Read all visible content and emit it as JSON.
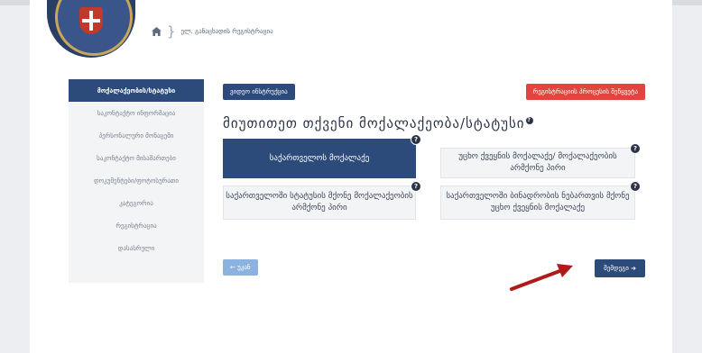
{
  "breadcrumb": {
    "text": "ელ. განაცხადის რეგისტრაცია"
  },
  "sidebar": {
    "items": [
      {
        "label": "მოქალაქეობის/სტატუსი"
      },
      {
        "label": "საკონტაქტო ინფორმაცია"
      },
      {
        "label": "პერსონალური მონაცემი"
      },
      {
        "label": "საკონტაქტო მისამართები"
      },
      {
        "label": "დოკუმენტები/ფოტოსურათი"
      },
      {
        "label": "კატეგორია"
      },
      {
        "label": "რეგისტრაცია"
      },
      {
        "label": "დასასრული"
      }
    ]
  },
  "main": {
    "top_left_button": "ვიდეო ინსტრუქცია",
    "top_right_button": "რეგისტრაციის პროცესის შეწყვეტა",
    "heading": "მიუთითეთ თქვენი მოქალაქეობა/სტატუსი",
    "options": [
      {
        "label": "საქართველოს მოქალაქე"
      },
      {
        "label": "უცხო ქვეყნის მოქალაქე/ მოქალაქეობის არმქონე პირი"
      },
      {
        "label": "საქართველოში სტატუსის მქონე მოქალაქეობის არმქონე პირი"
      },
      {
        "label": "საქართველოში ბინადრობის ნებართვის მქონე უცხო ქვეყნის მოქალაქე"
      }
    ],
    "back_button": "← უკან",
    "next_button": "შემდეგი ➜"
  },
  "colors": {
    "primary": "#2c4a7a",
    "danger": "#e0463f",
    "back": "#8cb3df",
    "annotation": "#b11a1a"
  },
  "icons": {
    "help": "?",
    "home": "home-icon"
  }
}
